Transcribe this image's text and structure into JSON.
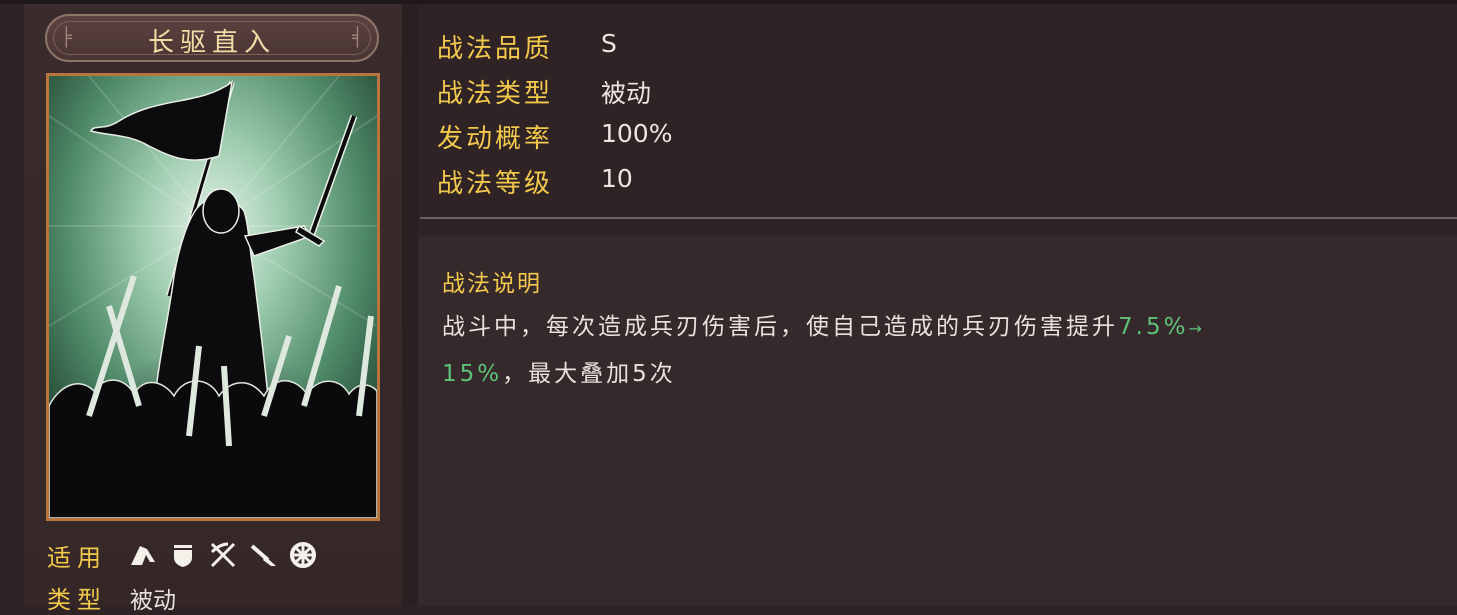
{
  "skill": {
    "name": "长驱直入"
  },
  "apply": {
    "label": "适用",
    "icons": [
      "cavalry-icon",
      "shield-icon",
      "crossed-bows-icon",
      "spear-icon",
      "wheel-icon"
    ]
  },
  "type_row": {
    "label": "类型",
    "value": "被动"
  },
  "stats": [
    {
      "label": "战法品质",
      "value": "S"
    },
    {
      "label": "战法类型",
      "value": "被动"
    },
    {
      "label": "发动概率",
      "value": "100%"
    },
    {
      "label": "战法等级",
      "value": "10"
    }
  ],
  "description": {
    "title": "战法说明",
    "line1_prefix": "战斗中，每次造成兵刃伤害后，使自己造成的兵刃伤害提升",
    "value_from": "7.5%",
    "arrow": "→",
    "value_to": "15%",
    "line2_suffix": "，最大叠加5次"
  },
  "colors": {
    "gold": "#f2c94c",
    "highlight_green": "#5fc07a",
    "card_border": "#b8763e"
  }
}
